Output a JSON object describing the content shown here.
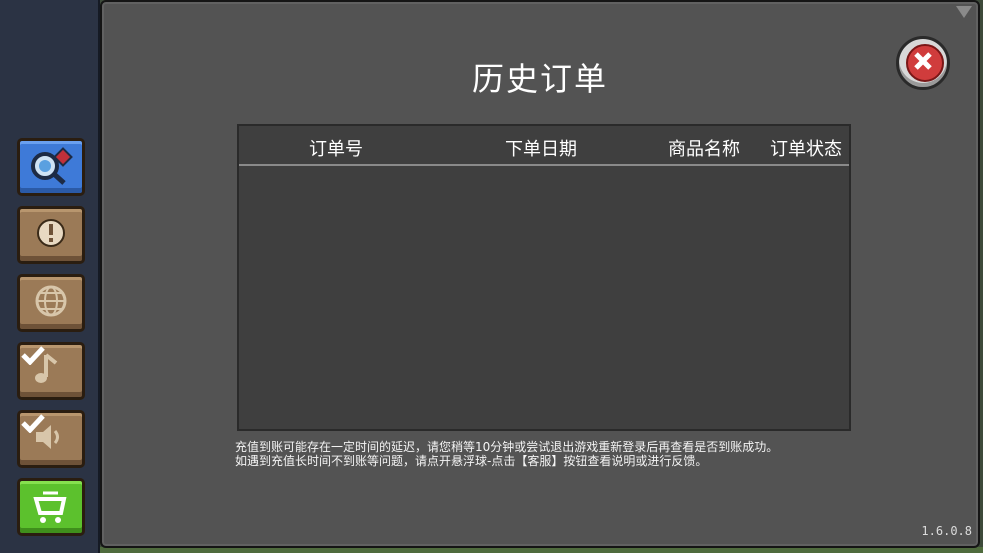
{
  "window": {
    "title": "历史订单",
    "version": "1.6.0.8"
  },
  "table": {
    "columns": [
      "订单号",
      "下单日期",
      "商品名称",
      "订单状态"
    ],
    "rows": []
  },
  "notes": {
    "line1": "充值到账可能存在一定时间的延迟，请您稍等10分钟或尝试退出游戏重新登录后再查看是否到账成功。",
    "line2": "如遇到充值长时间不到账等问题，请点开悬浮球-点击【客服】按钮查看说明或进行反馈。"
  },
  "sidebar": {
    "items": [
      {
        "icon": "search-key-icon",
        "state": "active"
      },
      {
        "icon": "exclamation-icon",
        "state": "normal"
      },
      {
        "icon": "globe-icon",
        "state": "normal"
      },
      {
        "icon": "music-note-icon",
        "state": "checked"
      },
      {
        "icon": "speaker-icon",
        "state": "checked"
      },
      {
        "icon": "shopping-cart-icon",
        "state": "highlight"
      }
    ]
  },
  "colors": {
    "panel": "#535353",
    "table": "#3f3f3f",
    "sidebar": "#2b3344",
    "accent_blue": "#3e7ad8",
    "accent_green": "#5cc12d",
    "close_red": "#d03c3c"
  }
}
